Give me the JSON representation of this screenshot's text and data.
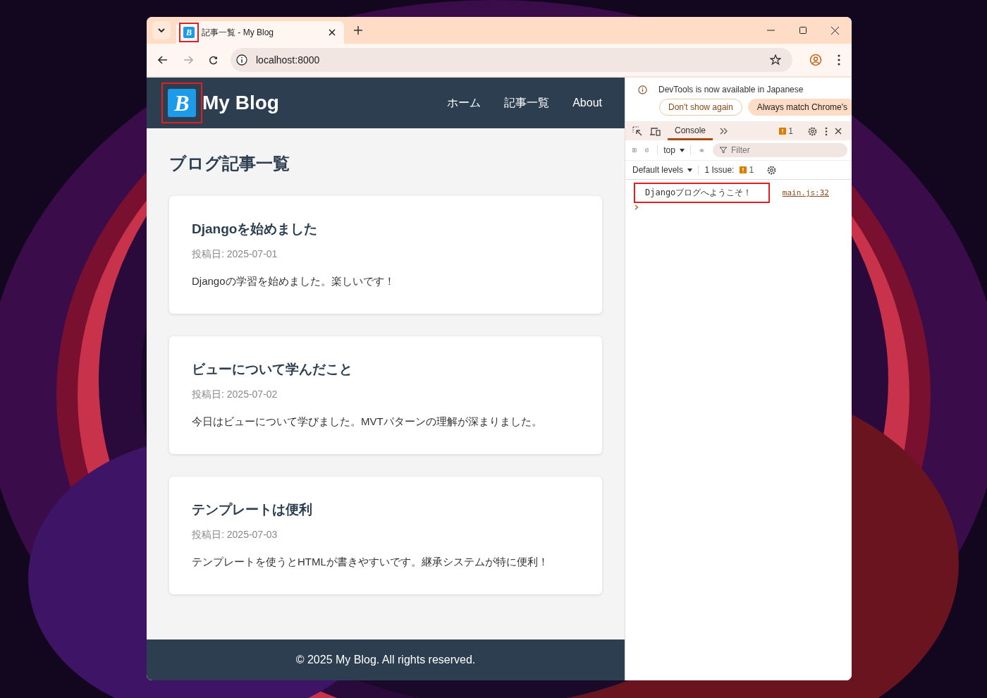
{
  "browser": {
    "tab": {
      "favicon_letter": "B",
      "favicon_highlighted": true,
      "title": "記事一覧 - My Blog"
    },
    "address": "localhost:8000"
  },
  "blog": {
    "logo": {
      "letter": "B",
      "highlighted": true
    },
    "site_title": "My Blog",
    "nav": [
      {
        "label": "ホーム"
      },
      {
        "label": "記事一覧"
      },
      {
        "label": "About"
      }
    ],
    "heading": "ブログ記事一覧",
    "posts": [
      {
        "title": "Djangoを始めました",
        "date": "投稿日: 2025-07-01",
        "body": "Djangoの学習を始めました。楽しいです！"
      },
      {
        "title": "ビューについて学んだこと",
        "date": "投稿日: 2025-07-02",
        "body": "今日はビューについて学びました。MVTパターンの理解が深まりました。"
      },
      {
        "title": "テンプレートは便利",
        "date": "投稿日: 2025-07-03",
        "body": "テンプレートを使うとHTMLが書きやすいです。継承システムが特に便利！"
      }
    ],
    "footer": "© 2025 My Blog. All rights reserved."
  },
  "devtools": {
    "notice": "DevTools is now available in Japanese",
    "notice_buttons": [
      {
        "label": "Don't show again",
        "kind": "outline"
      },
      {
        "label": "Always match Chrome's",
        "kind": "filled"
      }
    ],
    "tabs": [
      {
        "label": "Console",
        "selected": true
      }
    ],
    "issue_badge": "1",
    "context": "top",
    "filter_placeholder": "Filter",
    "levels": "Default levels",
    "issues_label": "1 Issue:",
    "issues_count": "1",
    "messages": [
      {
        "text": "Djangoブログへようこそ！",
        "source": "main.js:32",
        "highlighted": true
      }
    ]
  }
}
